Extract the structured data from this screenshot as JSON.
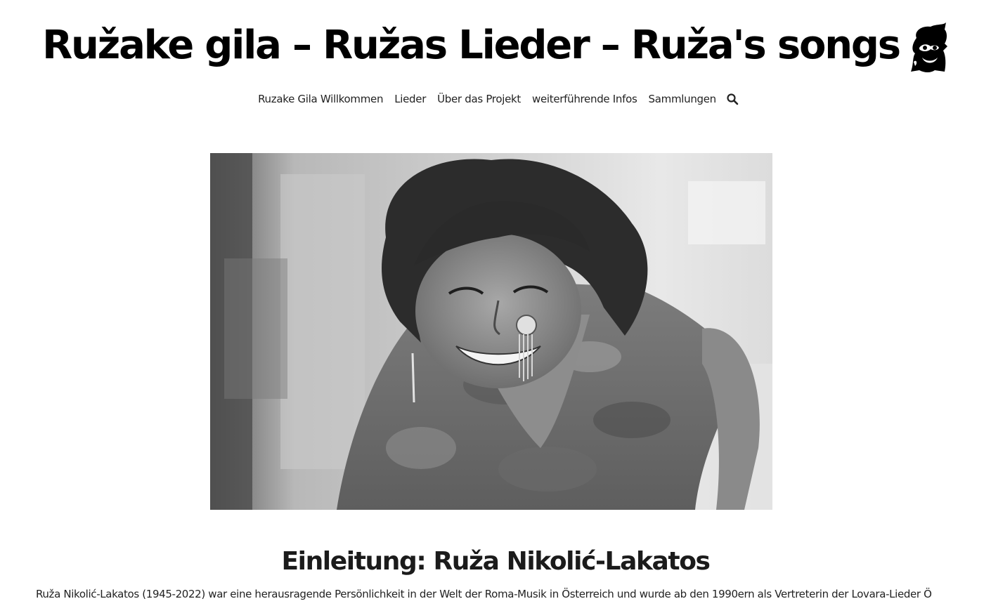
{
  "site": {
    "title": "Ružake gila – Ružas Lieder – Ruža's songs",
    "logo_icon": "portrait-logo-icon"
  },
  "nav": {
    "items": [
      {
        "label": "Ruzake Gila Willkommen"
      },
      {
        "label": "Lieder"
      },
      {
        "label": "Über das Projekt"
      },
      {
        "label": "weiterführende Infos"
      },
      {
        "label": "Sammlungen"
      }
    ],
    "search_icon": "search-icon"
  },
  "hero": {
    "image_kind": "black-and-white portrait photograph",
    "icon": "photo"
  },
  "content": {
    "heading": "Einleitung: Ruža Nikolić-Lakatos",
    "paragraph": "Ruža Nikolić-Lakatos (1945-2022) war eine herausragende Persönlichkeit in der Welt der Roma-Musik in Österreich und wurde ab den 1990ern als Vertreterin der Lovara-Lieder Ö"
  },
  "colors": {
    "background": "#ffffff",
    "text": "#1a1a1a",
    "title": "#000000"
  }
}
